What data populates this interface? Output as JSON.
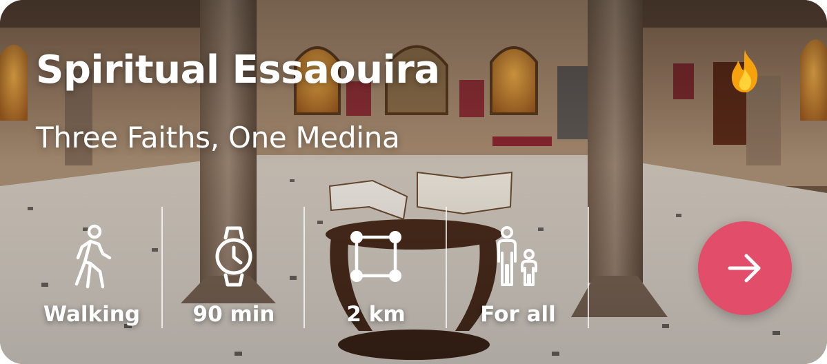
{
  "card": {
    "title": "Spiritual Essaouira",
    "subtitle": "Three Faiths, One Medina",
    "badge_icon": "flame-icon",
    "stats": [
      {
        "icon": "walking-person-icon",
        "label": "Walking"
      },
      {
        "icon": "watch-icon",
        "label": "90 min"
      },
      {
        "icon": "distance-square-icon",
        "label": "2 km"
      },
      {
        "icon": "adult-child-icon",
        "label": "For all"
      }
    ],
    "action": {
      "icon": "arrow-right-icon",
      "color": "#e24e6a"
    }
  },
  "colors": {
    "accent": "#e24e6a",
    "text": "#ffffff",
    "flame_outer": "#f6a20f",
    "flame_inner": "#ffd23a"
  }
}
